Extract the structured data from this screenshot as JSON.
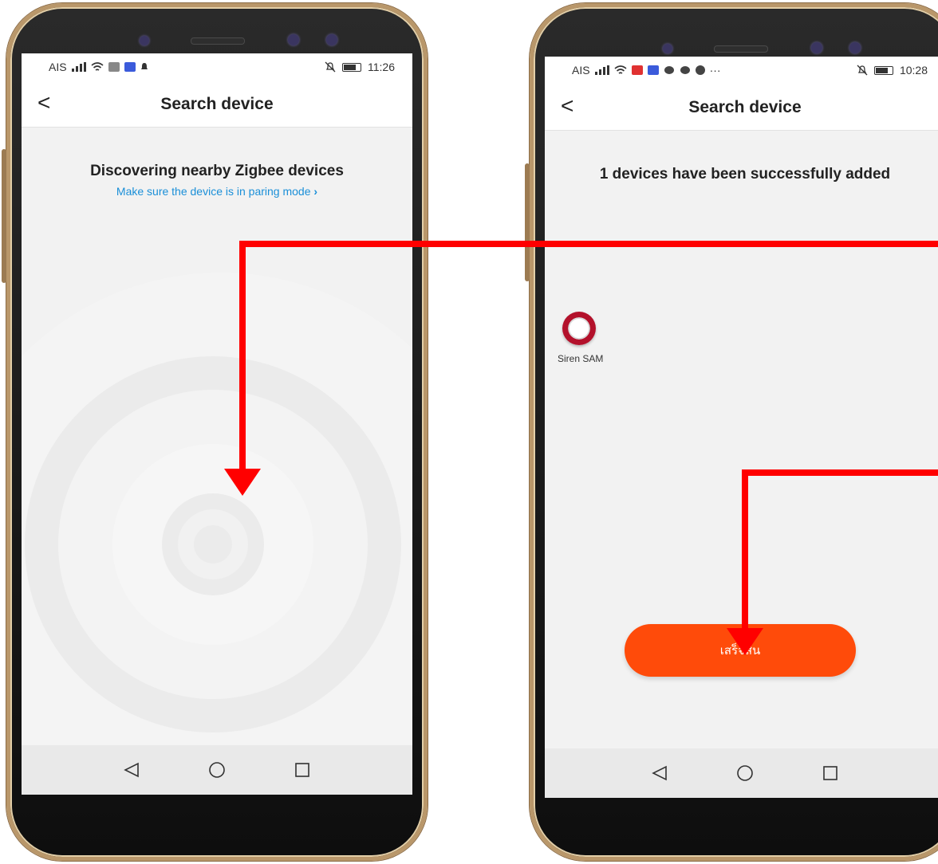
{
  "left_screen": {
    "status": {
      "carrier": "AIS",
      "time": "11:26"
    },
    "nav": {
      "back": "<",
      "title": "Search device"
    },
    "heading": "Discovering nearby Zigbee devices",
    "subtext": "Make sure the device is in paring mode",
    "subtext_chevron": "›"
  },
  "right_screen": {
    "status": {
      "carrier": "AIS",
      "time": "10:28",
      "more": "···"
    },
    "nav": {
      "back": "<",
      "title": "Search device"
    },
    "heading": "1 devices have been successfully added",
    "device": {
      "name": "Siren SAM"
    },
    "finish_button": "เสร็จสิ้น"
  },
  "colors": {
    "accent": "#ff4b0a",
    "link": "#1a8fd8",
    "annotation": "#ff0000"
  },
  "icons": [
    "back-chevron-icon",
    "signal-icon",
    "wifi-icon",
    "battery-icon",
    "mute-bell-icon",
    "back-triangle-icon",
    "home-circle-icon",
    "recents-square-icon",
    "siren-device-icon"
  ]
}
